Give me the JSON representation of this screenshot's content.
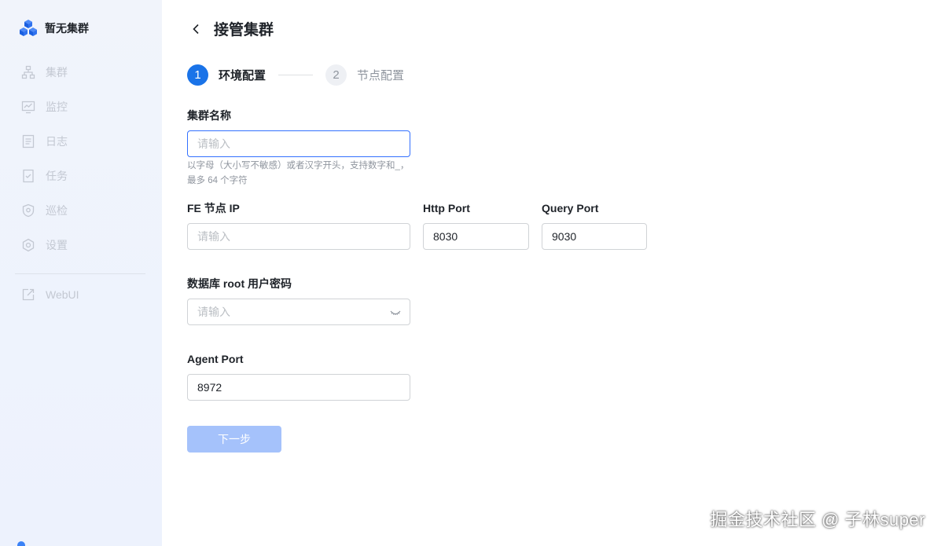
{
  "sidebar": {
    "brand_title": "暂无集群",
    "items": [
      {
        "label": "集群",
        "icon": "cluster-icon"
      },
      {
        "label": "监控",
        "icon": "monitor-icon"
      },
      {
        "label": "日志",
        "icon": "log-icon"
      },
      {
        "label": "任务",
        "icon": "task-icon"
      },
      {
        "label": "巡检",
        "icon": "inspect-icon"
      },
      {
        "label": "设置",
        "icon": "settings-icon"
      }
    ],
    "webui_label": "WebUI"
  },
  "header": {
    "title": "接管集群"
  },
  "steps": [
    {
      "number": "1",
      "label": "环境配置",
      "state": "active"
    },
    {
      "number": "2",
      "label": "节点配置",
      "state": "inactive"
    }
  ],
  "form": {
    "cluster_name": {
      "label": "集群名称",
      "placeholder": "请输入",
      "value": "",
      "hint": "以字母（大小写不敏感）或者汉字开头，支持数字和_，最多 64 个字符"
    },
    "fe_ip": {
      "label": "FE 节点 IP",
      "placeholder": "请输入",
      "value": ""
    },
    "http_port": {
      "label": "Http Port",
      "value": "8030"
    },
    "query_port": {
      "label": "Query Port",
      "value": "9030"
    },
    "root_password": {
      "label": "数据库 root 用户密码",
      "placeholder": "请输入",
      "value": ""
    },
    "agent_port": {
      "label": "Agent Port",
      "value": "8972"
    }
  },
  "actions": {
    "next_label": "下一步"
  },
  "watermark": "掘金技术社区 @ 子林super",
  "colors": {
    "primary": "#1a73e8",
    "disabled_button": "#a5c2fb",
    "sidebar_text": "#c3c8d2"
  }
}
